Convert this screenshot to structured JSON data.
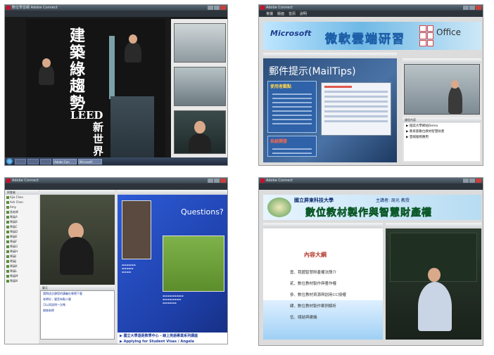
{
  "shot1": {
    "window_title": "數位學習網 Adobe Connect",
    "book_title_chars": [
      "建",
      "築",
      "綠",
      "趨",
      "勢"
    ],
    "book_leed": "LEED",
    "book_new_chars": [
      "新",
      "世",
      "界"
    ],
    "taskbar_item_1": "Adobe Con",
    "taskbar_item_2": "Microsoft"
  },
  "shot2": {
    "window_title": "Adobe Connect",
    "menu": [
      "會議",
      "版面",
      "音訊",
      "說明"
    ],
    "banner_brand": "Microsoft",
    "banner_title": "微軟雲端研習",
    "banner_product": "Office",
    "slide_title": "郵件提示(MailTips)",
    "box1_heading": "使用者觀點",
    "box2_heading": "系統開發",
    "course_list_title": "課程內容",
    "course_list": [
      "▶ 個案大學網站Demo",
      "▶ 教育部數位教材智慧財產",
      "▶ 雲端服務應用"
    ]
  },
  "shot3": {
    "window_title": "Adobe Connect",
    "attendees_title": "與會者",
    "attendees": [
      "Ajia Chen",
      "Ash Chen",
      "Amy",
      "張老師",
      "學員A",
      "學員B",
      "學員C",
      "學員D",
      "學員E",
      "學員F",
      "學員G",
      "學員H",
      "學員I",
      "學員J",
      "學員K",
      "學員L",
      "學員M",
      "學員N"
    ],
    "chat_title": "聊天",
    "chat_lines": [
      "請問這次課程的講義在哪裡下載",
      "老師好，聲音有點小聲",
      "可以再說明一次嗎",
      "謝謝老師"
    ],
    "slide_heading": "Questions?",
    "bottom_links": [
      "▶ 國立大學遠距教學中心 - 線上英語專業系列講座",
      "▶ Applying for Student Visas / Angela"
    ]
  },
  "shot4": {
    "window_title": "Adobe Connect",
    "university": "國立屏東科技大學",
    "host_label": "主講者: 周光 教授",
    "course_title": "數位教材製作與智慧財產權",
    "outline_title": "內容大綱",
    "outline_items": [
      "壹、我國智慧財產權法簡介",
      "貳、數位教材製作與著作權",
      "參、數位教材資源與創用CC授權",
      "肆、數位教材製作案例解析",
      "伍、總結與建議"
    ]
  },
  "colors": {
    "connect_dark": "#2d343b",
    "ms_banner": "#6fb9e6",
    "slide_blue": "#2c5bd6",
    "outline_red": "#b43b2e"
  }
}
